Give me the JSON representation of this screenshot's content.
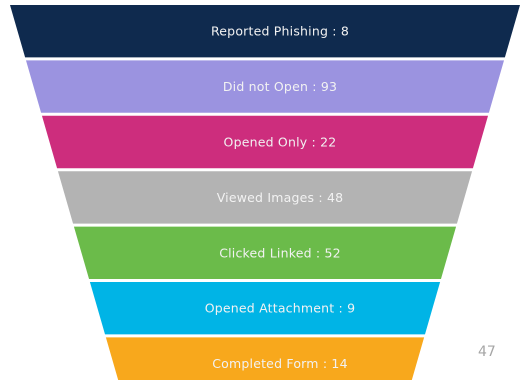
{
  "chart_data": {
    "type": "funnel",
    "title": "",
    "stages": [
      {
        "label": "Reported Phishing : 8",
        "name": "Reported Phishing",
        "value": 8,
        "color": "#0f2a4e"
      },
      {
        "label": "Did not Open : 93",
        "name": "Did not Open",
        "value": 93,
        "color": "#9b93e0"
      },
      {
        "label": "Opened Only : 22",
        "name": "Opened Only",
        "value": 22,
        "color": "#cd2d7d"
      },
      {
        "label": "Viewed Images : 48",
        "name": "Viewed Images",
        "value": 48,
        "color": "#b3b3b3"
      },
      {
        "label": "Clicked Linked : 52",
        "name": "Clicked Linked",
        "value": 52,
        "color": "#6bbb4a"
      },
      {
        "label": "Opened Attachment : 9",
        "name": "Opened Attachment",
        "value": 9,
        "color": "#00b4e6"
      },
      {
        "label": "Completed Form : 14",
        "name": "Completed Form",
        "value": 14,
        "color": "#f8a81c"
      }
    ]
  },
  "page": {
    "page_number": "47"
  }
}
